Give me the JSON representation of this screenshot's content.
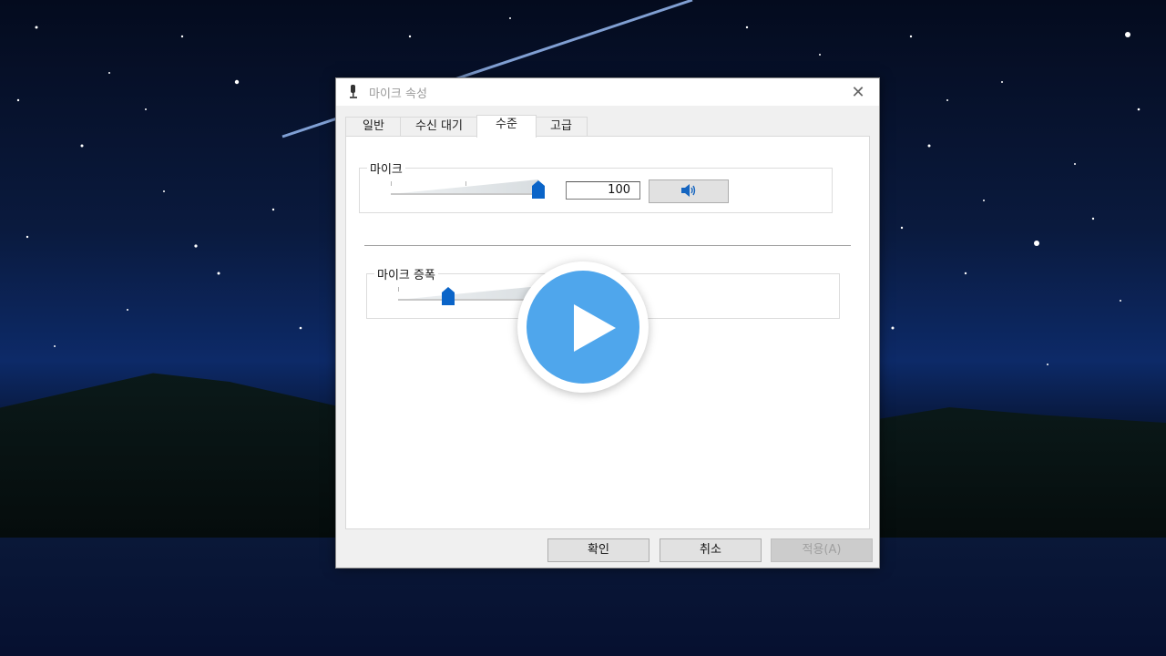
{
  "window": {
    "title": "마이크 속성",
    "close_glyph": "✕"
  },
  "tabs": [
    {
      "label": "일반",
      "active": false
    },
    {
      "label": "수신 대기",
      "active": false
    },
    {
      "label": "수준",
      "active": true
    },
    {
      "label": "고급",
      "active": false
    }
  ],
  "levels": {
    "microphone": {
      "label": "마이크",
      "value": "100",
      "level_fraction": 1.0
    },
    "boost": {
      "label": "마이크 증폭",
      "level_fraction": 0.34
    }
  },
  "buttons": {
    "ok": "확인",
    "cancel": "취소",
    "apply": "적용(A)"
  },
  "colors": {
    "accent": "#0a64c8",
    "play_button": "#4fa6ec"
  },
  "icons": {
    "window_icon": "microphone-icon",
    "speaker": "speaker-icon",
    "overlay": "play-icon"
  }
}
